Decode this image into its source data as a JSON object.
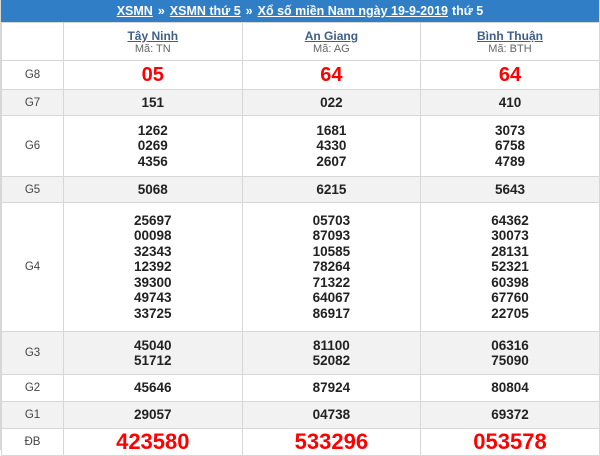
{
  "breadcrumb": {
    "link1": "XSMN",
    "sep1": "»",
    "link2": "XSMN thứ 5",
    "sep2": "»",
    "link3": "Xổ số miền Nam ngày 19-9-2019",
    "tail": "thứ 5"
  },
  "provinces": [
    {
      "name": "Tây Ninh",
      "code": "Mã: TN"
    },
    {
      "name": "An Giang",
      "code": "Mã: AG"
    },
    {
      "name": "Bình Thuận",
      "code": "Mã: BTH"
    }
  ],
  "prizes": [
    {
      "label": "G8",
      "values": [
        [
          "05"
        ],
        [
          "64"
        ],
        [
          "64"
        ]
      ]
    },
    {
      "label": "G7",
      "values": [
        [
          "151"
        ],
        [
          "022"
        ],
        [
          "410"
        ]
      ]
    },
    {
      "label": "G6",
      "values": [
        [
          "1262",
          "0269",
          "4356"
        ],
        [
          "1681",
          "4330",
          "2607"
        ],
        [
          "3073",
          "6758",
          "4789"
        ]
      ]
    },
    {
      "label": "G5",
      "values": [
        [
          "5068"
        ],
        [
          "6215"
        ],
        [
          "5643"
        ]
      ]
    },
    {
      "label": "G4",
      "values": [
        [
          "25697",
          "00098",
          "32343",
          "12392",
          "39300",
          "49743",
          "33725"
        ],
        [
          "05703",
          "87093",
          "10585",
          "78264",
          "71322",
          "64067",
          "86917"
        ],
        [
          "64362",
          "30073",
          "28131",
          "52321",
          "60398",
          "67760",
          "22705"
        ]
      ]
    },
    {
      "label": "G3",
      "values": [
        [
          "45040",
          "51712"
        ],
        [
          "81100",
          "52082"
        ],
        [
          "06316",
          "75090"
        ]
      ]
    },
    {
      "label": "G2",
      "values": [
        [
          "45646"
        ],
        [
          "87924"
        ],
        [
          "80804"
        ]
      ]
    },
    {
      "label": "G1",
      "values": [
        [
          "29057"
        ],
        [
          "04738"
        ],
        [
          "69372"
        ]
      ]
    },
    {
      "label": "ĐB",
      "values": [
        [
          "423580"
        ],
        [
          "533296"
        ],
        [
          "053578"
        ]
      ]
    }
  ],
  "colors": {
    "banner": "#2f7ec6",
    "highlight": "#ff0000",
    "alt_row": "#f2f2f2"
  }
}
